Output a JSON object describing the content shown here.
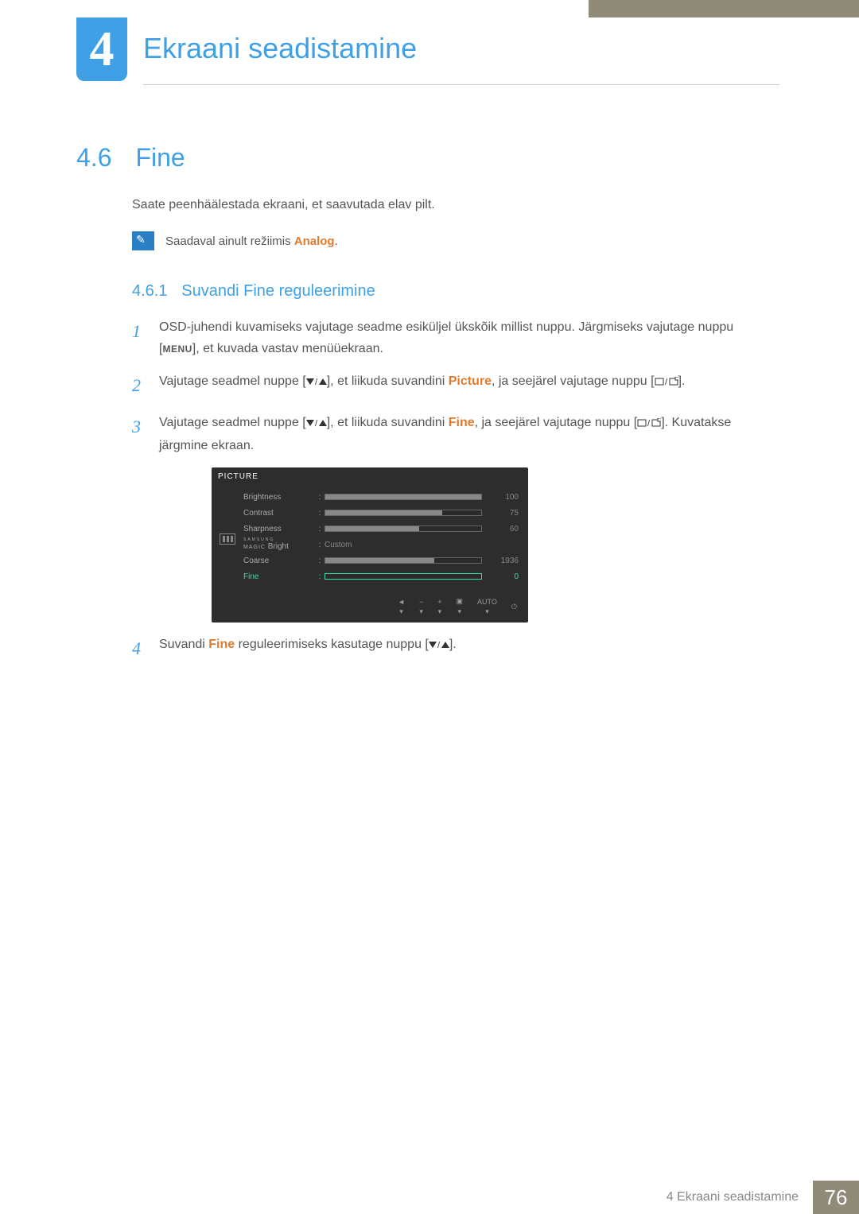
{
  "chapter": {
    "number": "4",
    "title": "Ekraani seadistamine"
  },
  "section": {
    "number": "4.6",
    "title": "Fine",
    "intro": "Saate peenhäälestada ekraani, et saavutada elav pilt.",
    "note_prefix": "Saadaval ainult režiimis ",
    "note_highlight": "Analog",
    "note_suffix": "."
  },
  "subsection": {
    "number": "4.6.1",
    "title": "Suvandi Fine reguleerimine"
  },
  "steps": {
    "s1a": "OSD-juhendi kuvamiseks vajutage seadme esiküljel ükskõik millist nuppu. Järgmiseks vajutage nuppu [",
    "s1_menu": "MENU",
    "s1b": "], et kuvada vastav menüüekraan.",
    "s2a": "Vajutage seadmel nuppe [",
    "s2b": "], et liikuda suvandini ",
    "s2_hl": "Picture",
    "s2c": ", ja seejärel vajutage nuppu [",
    "s2d": "].",
    "s3a": "Vajutage seadmel nuppe [",
    "s3b": "], et liikuda suvandini ",
    "s3_hl": "Fine",
    "s3c": ", ja seejärel vajutage nuppu [",
    "s3d": "]. Kuvatakse järgmine ekraan.",
    "s4a": "Suvandi ",
    "s4_hl": "Fine",
    "s4b": " reguleerimiseks kasutage nuppu [",
    "s4c": "]."
  },
  "osd": {
    "title": "PICTURE",
    "rows": {
      "brightness": {
        "label": "Brightness",
        "value": "100",
        "fill": 100
      },
      "contrast": {
        "label": "Contrast",
        "value": "75",
        "fill": 75
      },
      "sharpness": {
        "label": "Sharpness",
        "value": "60",
        "fill": 60
      },
      "magic": {
        "label_top": "SAMSUNG",
        "label_bottom": "MAGIC",
        "suffix": "Bright",
        "value": "Custom"
      },
      "coarse": {
        "label": "Coarse",
        "value": "1936",
        "fill": 70
      },
      "fine": {
        "label": "Fine",
        "value": "0",
        "fill": 0
      }
    },
    "footer_auto": "AUTO"
  },
  "footer": {
    "text": "4 Ekraani seadistamine",
    "page": "76"
  }
}
